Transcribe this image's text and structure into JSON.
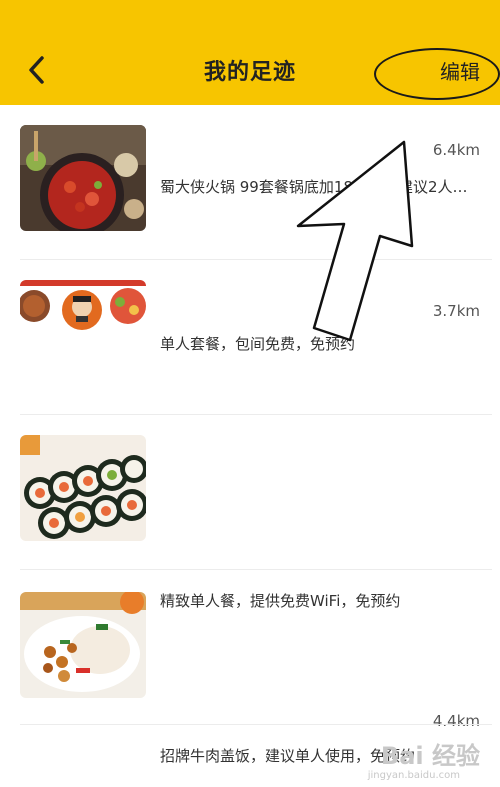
{
  "header": {
    "title": "我的足迹",
    "edit_label": "编辑",
    "background": "#f7c500"
  },
  "items": [
    {
      "distance": "6.4km",
      "description": "蜀大侠火锅 99套餐锅底加18道菜，建议2人…",
      "image": "hotpot"
    },
    {
      "distance": "3.7km",
      "description": "单人套餐，包间免费，免预约",
      "image": "restaurant-logo"
    },
    {
      "distance": "",
      "description": "精致单人餐，提供免费WiFi，免预约",
      "image": "sushi-rolls"
    },
    {
      "distance": "4.4km",
      "description": "招牌牛肉盖饭，建议单人使用，免预约",
      "image": "beef-rice"
    }
  ],
  "watermark": {
    "text": "Bai 经验",
    "sub": "jingyan.baidu.com"
  }
}
